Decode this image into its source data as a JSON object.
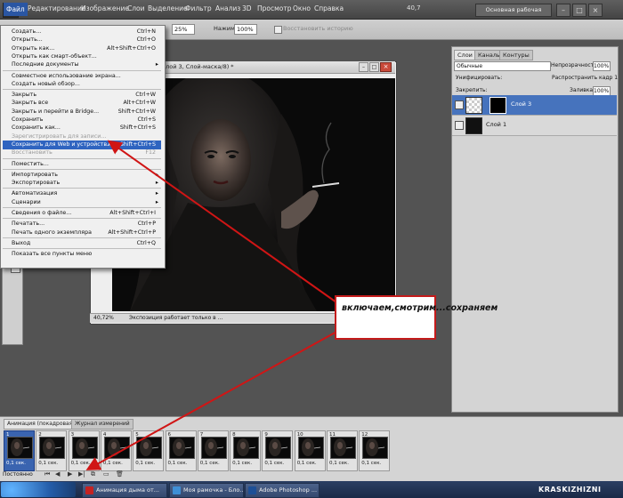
{
  "app": {
    "logo": "Ps",
    "menu": [
      "Файл",
      "Редактирование",
      "Изображение",
      "Слои",
      "Выделение",
      "Фильтр",
      "Анализ",
      "3D",
      "Просмотр",
      "Окно",
      "Справка"
    ],
    "zoom_display": "40,7",
    "workspace": "Основная рабочая среда"
  },
  "options_bar": {
    "zoom_value": "25%",
    "pressure_label": "Нажим:",
    "pressure_value": "100%",
    "restore_label": "Восстановить историю"
  },
  "file_menu": {
    "items": [
      {
        "label": "Создать...",
        "shortcut": "Ctrl+N",
        "disabled": false
      },
      {
        "label": "Открыть...",
        "shortcut": "Ctrl+O",
        "disabled": false
      },
      {
        "label": "Открыть как...",
        "shortcut": "Alt+Shift+Ctrl+O",
        "disabled": false
      },
      {
        "label": "Открыть как смарт-объект...",
        "shortcut": "",
        "disabled": false
      },
      {
        "label": "Последние документы",
        "shortcut": "",
        "submenu": true,
        "disabled": false
      },
      {
        "sep": true
      },
      {
        "label": "Совместное использование экрана...",
        "shortcut": "",
        "disabled": false
      },
      {
        "label": "Создать новый обзор...",
        "shortcut": "",
        "disabled": false
      },
      {
        "sep": true
      },
      {
        "label": "Закрыть",
        "shortcut": "Ctrl+W",
        "disabled": false
      },
      {
        "label": "Закрыть все",
        "shortcut": "Alt+Ctrl+W",
        "disabled": false
      },
      {
        "label": "Закрыть и перейти в Bridge...",
        "shortcut": "Shift+Ctrl+W",
        "disabled": false
      },
      {
        "label": "Сохранить",
        "shortcut": "Ctrl+S",
        "disabled": false
      },
      {
        "label": "Сохранить как...",
        "shortcut": "Shift+Ctrl+S",
        "disabled": false
      },
      {
        "label": "Зарегистрировать для записи...",
        "shortcut": "",
        "disabled": true
      },
      {
        "label": "Сохранить для Web и устройств...",
        "shortcut": "Alt+Shift+Ctrl+S",
        "highlight": true,
        "disabled": false
      },
      {
        "label": "Восстановить",
        "shortcut": "F12",
        "disabled": true
      },
      {
        "sep": true
      },
      {
        "label": "Поместить...",
        "shortcut": "",
        "disabled": false
      },
      {
        "sep": true
      },
      {
        "label": "Импортировать",
        "shortcut": "",
        "submenu": true,
        "disabled": false
      },
      {
        "label": "Экспортировать",
        "shortcut": "",
        "submenu": true,
        "disabled": false
      },
      {
        "sep": true
      },
      {
        "label": "Автоматизация",
        "shortcut": "",
        "submenu": true,
        "disabled": false
      },
      {
        "label": "Сценарии",
        "shortcut": "",
        "submenu": true,
        "disabled": false
      },
      {
        "sep": true
      },
      {
        "label": "Сведения о файле...",
        "shortcut": "Alt+Shift+Ctrl+I",
        "disabled": false
      },
      {
        "sep": true
      },
      {
        "label": "Печатать...",
        "shortcut": "Ctrl+P",
        "disabled": false
      },
      {
        "label": "Печать одного экземпляра",
        "shortcut": "Alt+Shift+Ctrl+P",
        "disabled": false
      },
      {
        "sep": true
      },
      {
        "label": "Выход",
        "shortcut": "Ctrl+Q",
        "disabled": false
      },
      {
        "sep": true
      },
      {
        "label": "Показать все пункты меню",
        "shortcut": "",
        "disabled": false
      }
    ]
  },
  "document": {
    "title": "(Слой 3, Слой-маска/8) *",
    "zoom": "40,72%",
    "status": "Экспозиция работает только в ..."
  },
  "layers_panel": {
    "tabs": [
      "Слои",
      "Каналы",
      "Контуры"
    ],
    "blend_mode": "Обычные",
    "opacity_label": "Непрозрачность:",
    "opacity_value": "100%",
    "unify_label": "Унифицировать:",
    "propagate_label": "Распространить кадр 1",
    "lock_label": "Закрепить:",
    "fill_label": "Заливка:",
    "fill_value": "100%",
    "layers": [
      {
        "name": "Слой 3",
        "selected": true
      },
      {
        "name": "Слой 1",
        "selected": false
      }
    ]
  },
  "callout": {
    "text": "включаем,смотрим...сохраняем"
  },
  "animation_panel": {
    "tabs": [
      "Анимация (покадровая)",
      "Журнал измерений"
    ],
    "loop": "Постоянно",
    "frames": [
      {
        "n": "1",
        "delay": "0,1 сек.",
        "selected": true
      },
      {
        "n": "2",
        "delay": "0,1 сек."
      },
      {
        "n": "3",
        "delay": "0,1 сек."
      },
      {
        "n": "4",
        "delay": "0,1 сек."
      },
      {
        "n": "5",
        "delay": "0,1 сек."
      },
      {
        "n": "6",
        "delay": "0,1 сек."
      },
      {
        "n": "7",
        "delay": "0,1 сек."
      },
      {
        "n": "8",
        "delay": "0,1 сек."
      },
      {
        "n": "9",
        "delay": "0,1 сек."
      },
      {
        "n": "10",
        "delay": "0,1 сек."
      },
      {
        "n": "11",
        "delay": "0,1 сек."
      },
      {
        "n": "12",
        "delay": "0,1 сек."
      }
    ]
  },
  "taskbar": {
    "tasks": [
      "Анимация дыма от...",
      "Моя рамочка - Бло...",
      "Adobe Photoshop ..."
    ],
    "watermark": "KRASKIZHIZNI"
  },
  "colors": {
    "highlight": "#2f64c0",
    "callout_border": "#c41b1b",
    "arrow": "#d01515",
    "selected_layer": "#4673bd"
  }
}
